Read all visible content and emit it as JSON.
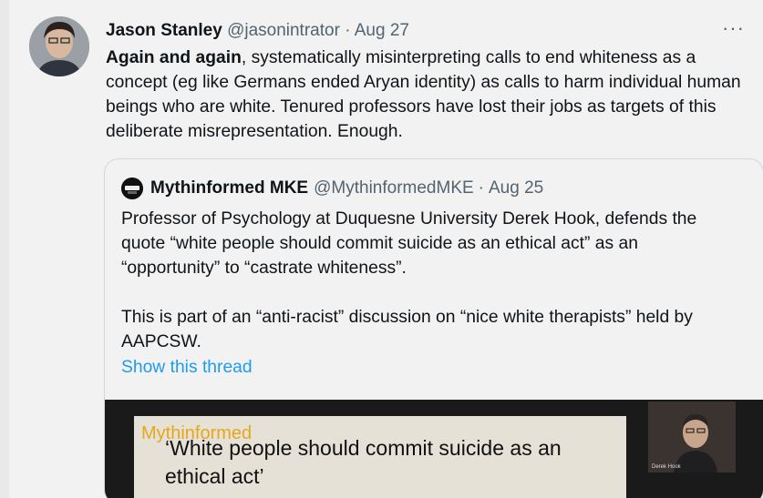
{
  "tweet": {
    "author_name": "Jason Stanley",
    "handle": "@jasonintrator",
    "separator": "·",
    "date": "Aug 27",
    "more_icon": "···",
    "text_bold": "Again and again",
    "text_rest": ", systematically misinterpreting calls to end whiteness as a concept (eg like Germans ended Aryan identity) as calls to harm individual human beings who are white. Tenured professors have lost their jobs as targets of this deliberate misrepresentation. Enough."
  },
  "quoted": {
    "author_name": "Mythinformed MKE",
    "handle": "@MythinformedMKE",
    "separator": "·",
    "date": "Aug 25",
    "paragraph1": "Professor of Psychology at Duquesne University Derek Hook, defends the quote “white people should commit suicide as an ethical act” as an “opportunity” to “castrate whiteness”.",
    "paragraph2": "This is part of an “anti-racist” discussion on “nice white therapists” held by AAPCSW.",
    "show_thread": "Show this thread",
    "media": {
      "watermark": "Mythinformed",
      "slide_text": "‘White people should commit suicide as an ethical act’",
      "webcam_label": "Derek Hook"
    }
  },
  "colors": {
    "link": "#1d9bf0",
    "secondary_text": "#536471",
    "watermark": "#e6a81a"
  }
}
